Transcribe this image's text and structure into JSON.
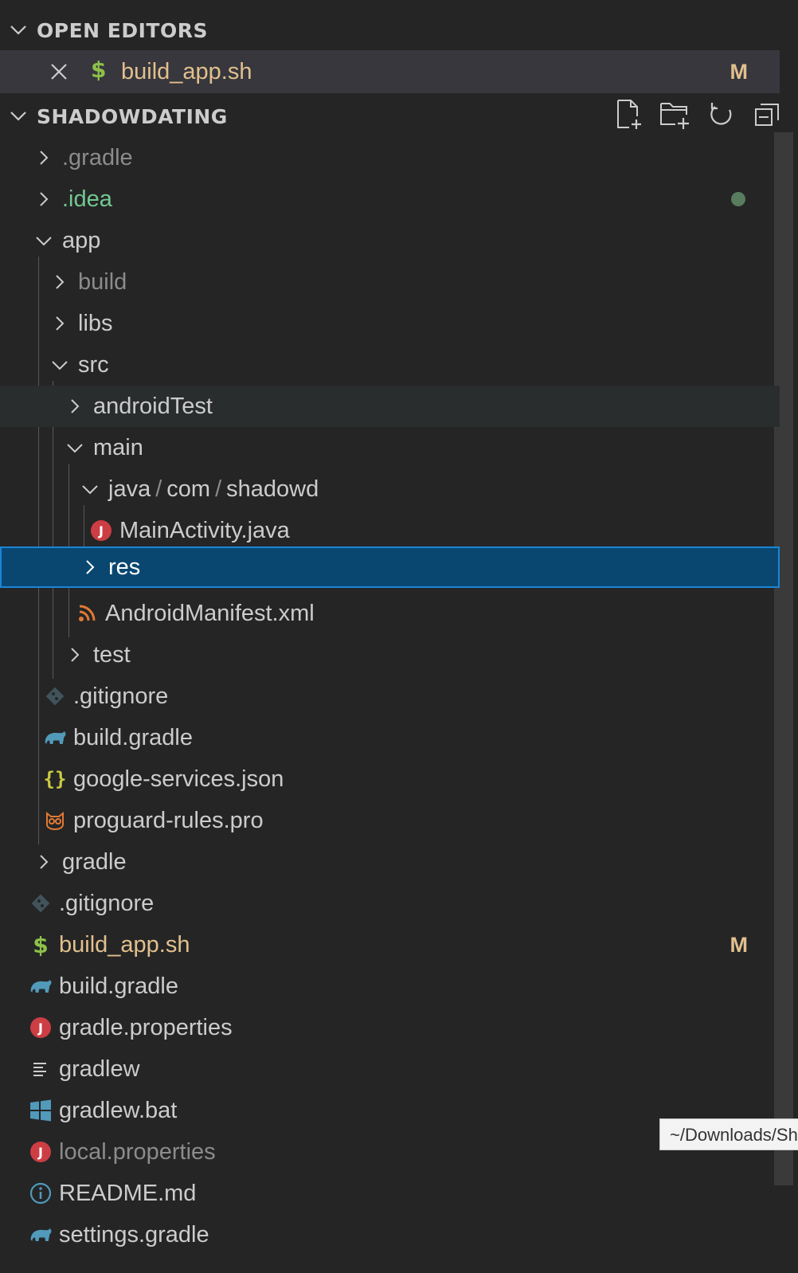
{
  "open_editors": {
    "title": "OPEN EDITORS",
    "items": [
      {
        "label": "build_app.sh",
        "badge": "M"
      }
    ]
  },
  "explorer": {
    "title": "SHADOWDATING",
    "tree": [
      {
        "label": ".gradle"
      },
      {
        "label": ".idea"
      },
      {
        "label": "app"
      },
      {
        "label": "build"
      },
      {
        "label": "libs"
      },
      {
        "label": "src"
      },
      {
        "label": "androidTest"
      },
      {
        "label": "main"
      },
      {
        "path": [
          "java",
          "com",
          "shadowd"
        ]
      },
      {
        "label": "MainActivity.java"
      },
      {
        "label": "res"
      },
      {
        "label": "AndroidManifest.xml"
      },
      {
        "label": "test"
      },
      {
        "label": ".gitignore"
      },
      {
        "label": "build.gradle"
      },
      {
        "label": "google-services.json"
      },
      {
        "label": "proguard-rules.pro"
      },
      {
        "label": "gradle"
      },
      {
        "label": ".gitignore"
      },
      {
        "label": "build_app.sh",
        "badge": "M"
      },
      {
        "label": "build.gradle"
      },
      {
        "label": "gradle.properties"
      },
      {
        "label": "gradlew"
      },
      {
        "label": "gradlew.bat"
      },
      {
        "label": "local.properties"
      },
      {
        "label": "README.md"
      },
      {
        "label": "settings.gradle"
      }
    ]
  },
  "path_separator": "/",
  "tooltip": "~/Downloads/Sh",
  "colors": {
    "sidebar_bg": "#252526",
    "selected_bg": "#094771",
    "selected_border": "#1a85d6",
    "modified": "#e2c08d",
    "untracked": "#73c991",
    "ignored": "#8c8c8c"
  }
}
